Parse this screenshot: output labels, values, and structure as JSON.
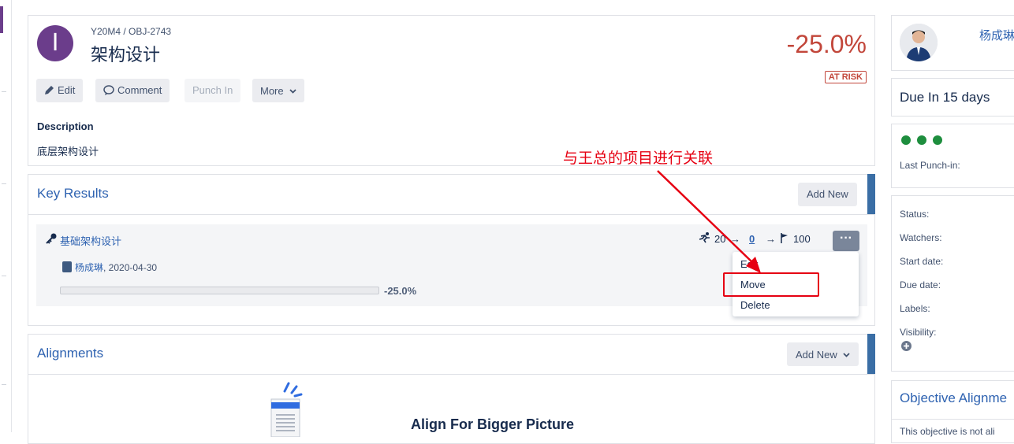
{
  "objective": {
    "breadcrumb": "Y20M4 / OBJ-2743",
    "title": "架构设计",
    "avatar_letter": "I",
    "progress_text": "-25.0%",
    "status_badge": "AT RISK",
    "actions": {
      "edit": "Edit",
      "comment": "Comment",
      "punch_in": "Punch In",
      "more": "More"
    },
    "description_heading": "Description",
    "description_text": "底层架构设计"
  },
  "key_results": {
    "heading": "Key Results",
    "add_new": "Add New",
    "items": [
      {
        "name": "基础架构设计",
        "owner": "杨成琳",
        "date": ", 2020-04-30",
        "start": "20",
        "current": "0",
        "target": "100",
        "progress_text": "-25.0%",
        "progress_fraction": 0
      }
    ],
    "menu": {
      "edit": "Edit",
      "move": "Move",
      "delete": "Delete"
    }
  },
  "alignments": {
    "heading": "Alignments",
    "add_new": "Add New",
    "empty_title": "Align For Bigger Picture"
  },
  "sidebar": {
    "owner_name": "杨成琳",
    "due": "Due In 15 days",
    "last_punch_label": "Last Punch-in:",
    "fields": [
      "Status:",
      "Watchers:",
      "Start date:",
      "Due date:",
      "Labels:",
      "Visibility:"
    ],
    "objective_alignment": "Objective Alignme",
    "alignment_note": "This objective is not ali"
  },
  "annotation": {
    "text": "与王总的项目进行关联"
  },
  "colors": {
    "brand": "#6b3d8b",
    "risk": "#c2463a",
    "link": "#2f63b1",
    "annotation": "#e60012",
    "dot": "#1e8e3e"
  }
}
